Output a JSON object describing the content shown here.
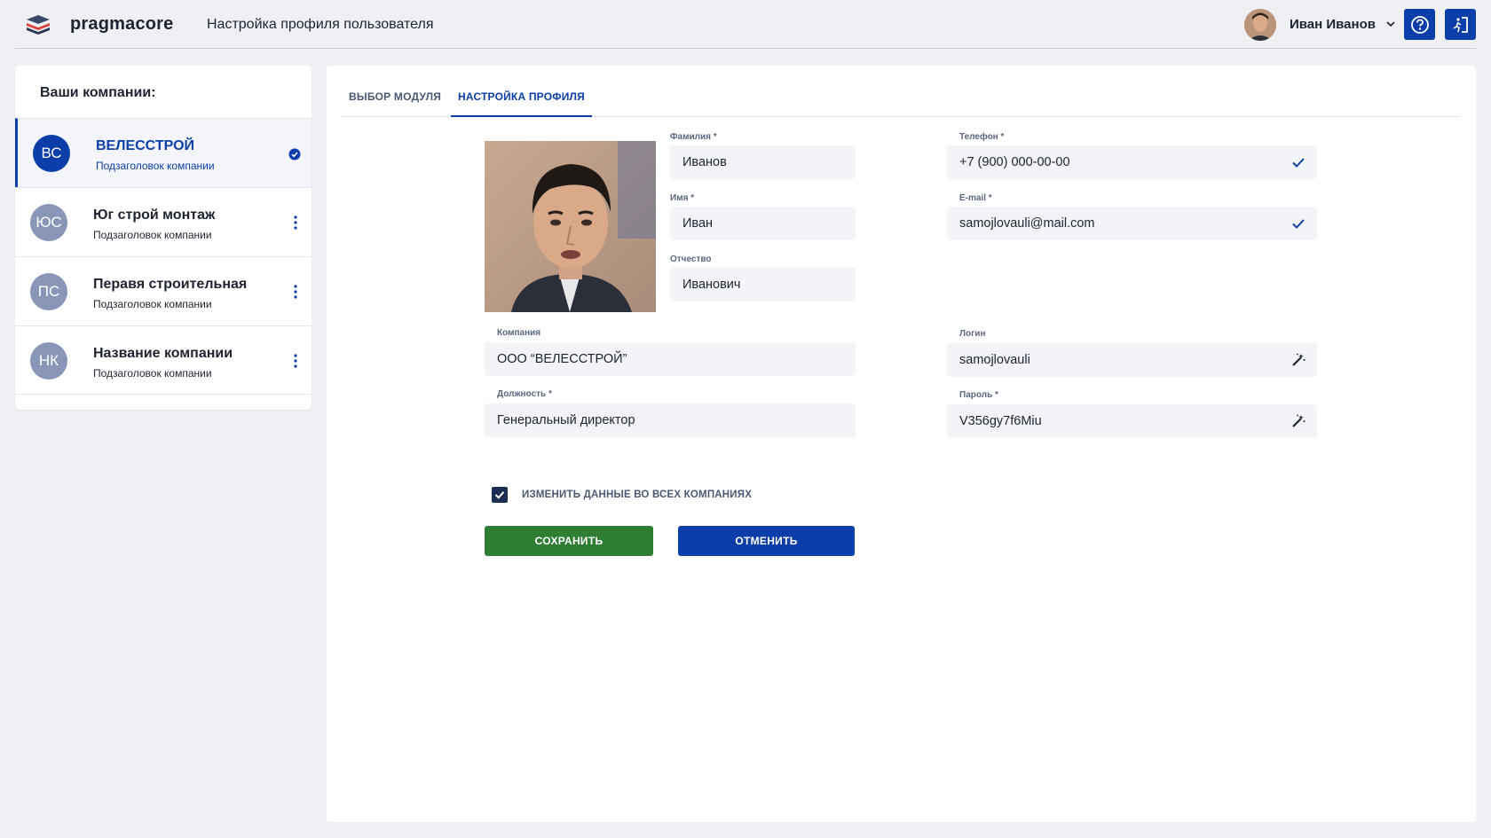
{
  "header": {
    "brand": "pragmacore",
    "page_title": "Настройка профиля пользователя",
    "user_name": "Иван Иванов"
  },
  "sidebar": {
    "title": "Ваши компании:",
    "companies": [
      {
        "initials": "ВС",
        "name": "ВЕЛЕССТРОЙ",
        "subtitle": "Подзаголовок компании",
        "color": "#0b3ea8"
      },
      {
        "initials": "ЮС",
        "name": "Юг строй монтаж",
        "subtitle": "Подзаголовок компании",
        "color": "#8a96b8"
      },
      {
        "initials": "ПС",
        "name": "Перавя строительная",
        "subtitle": "Подзаголовок компании",
        "color": "#8a96b8"
      },
      {
        "initials": "НК",
        "name": "Название компании",
        "subtitle": "Подзаголовок компании",
        "color": "#8a96b8"
      }
    ]
  },
  "tabs": [
    {
      "label": "ВЫБОР МОДУЛЯ"
    },
    {
      "label": "НАСТРОЙКА ПРОФИЛЯ"
    }
  ],
  "form": {
    "last_name": {
      "label": "Фамилия *",
      "value": "Иванов"
    },
    "first_name": {
      "label": "Имя *",
      "value": "Иван"
    },
    "middle_name": {
      "label": "Отчество",
      "value": "Иванович"
    },
    "company": {
      "label": "Компания",
      "value": "ООО “ВЕЛЕССТРОЙ”"
    },
    "position": {
      "label": "Должность *",
      "value": "Генеральный директор"
    },
    "phone": {
      "label": "Телефон *",
      "value": "+7 (900) 000-00-00"
    },
    "email": {
      "label": "E-mail *",
      "value": "samojlovauli@mail.com"
    },
    "login": {
      "label": "Логин",
      "value": "samojlovauli"
    },
    "password": {
      "label": "Пароль *",
      "value": "V356gy7f6Miu"
    },
    "apply_all_label": "ИЗМЕНИТЬ ДАННЫЕ ВО ВСЕХ КОМПАНИЯХ",
    "save_label": "СОХРАНИТЬ",
    "cancel_label": "ОТМЕНИТЬ"
  }
}
